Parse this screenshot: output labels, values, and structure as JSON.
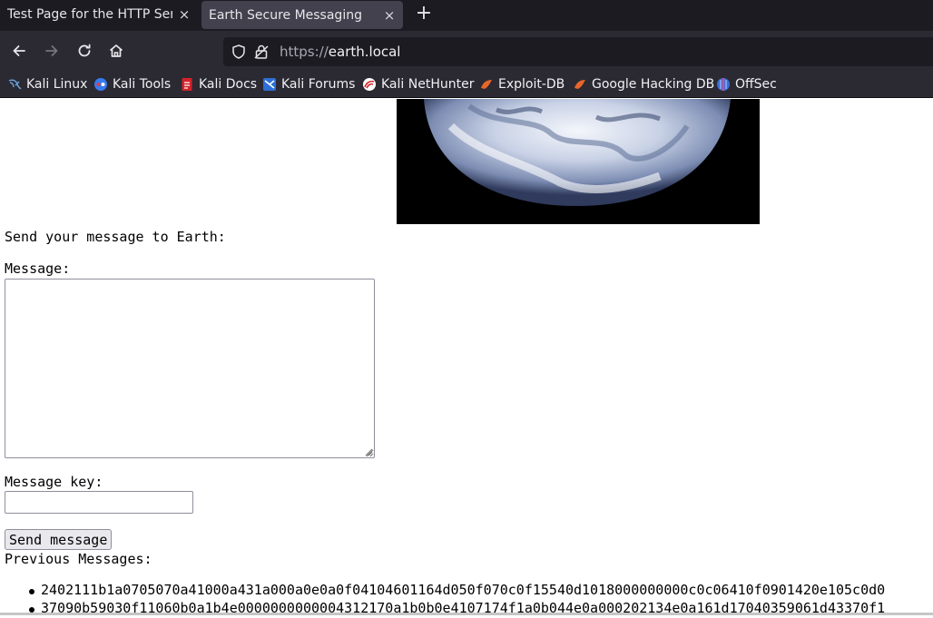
{
  "browser": {
    "tabs": [
      {
        "title": "Test Page for the HTTP Serve",
        "active": false
      },
      {
        "title": "Earth Secure Messaging",
        "active": true
      }
    ],
    "new_tab_label": "+",
    "close_glyph": "×",
    "url": {
      "scheme": "https://",
      "host": "earth.local"
    },
    "bookmarks": [
      {
        "label": "Kali Linux",
        "icon": "kali-dragon-icon"
      },
      {
        "label": "Kali Tools",
        "icon": "kali-tools-icon"
      },
      {
        "label": "Kali Docs",
        "icon": "kali-docs-icon"
      },
      {
        "label": "Kali Forums",
        "icon": "kali-forums-icon"
      },
      {
        "label": "Kali NetHunter",
        "icon": "kali-nethunter-icon"
      },
      {
        "label": "Exploit-DB",
        "icon": "exploit-db-icon"
      },
      {
        "label": "Google Hacking DB",
        "icon": "ghdb-icon"
      },
      {
        "label": "OffSec",
        "icon": "offsec-icon"
      }
    ]
  },
  "page": {
    "heading": "Send your message to Earth:",
    "message_label": "Message:",
    "message_value": "",
    "key_label": "Message key:",
    "key_value": "",
    "send_label": "Send message",
    "previous_label": "Previous Messages:",
    "previous_messages": [
      "2402111b1a0705070a41000a431a000a0e0a0f04104601164d050f070c0f15540d1018000000000c0c06410f0901420e105c0d0",
      "37090b59030f11060b0a1b4e0000000000004312170a1b0b0e4107174f1a0b044e0a000202134e0a161d17040359061d43370f1"
    ]
  },
  "colors": {
    "tab_bar": "#1c1b22",
    "toolbar": "#2b2a33",
    "active_tab": "#42414d",
    "page_bg": "#ffffff"
  }
}
